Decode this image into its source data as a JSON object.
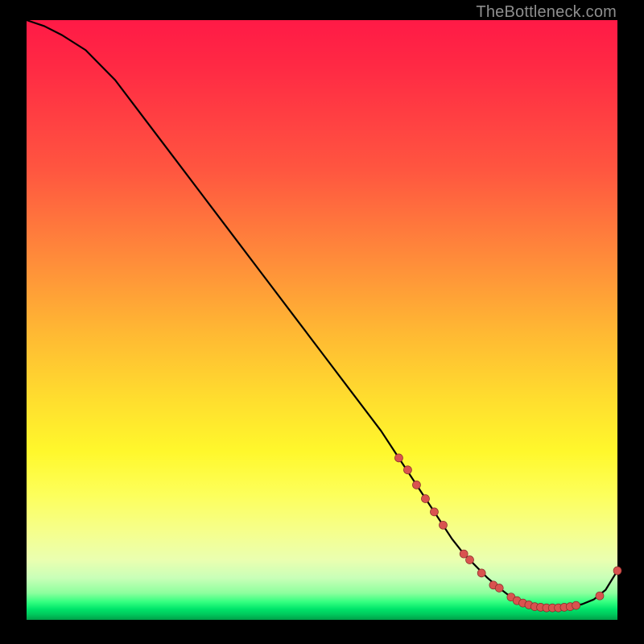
{
  "watermark": "TheBottleneck.com",
  "chart_data": {
    "type": "line",
    "title": "",
    "xlabel": "",
    "ylabel": "",
    "xlim": [
      0,
      100
    ],
    "ylim": [
      0,
      100
    ],
    "grid": false,
    "legend": false,
    "series": [
      {
        "name": "curve",
        "x": [
          0,
          3,
          6,
          10,
          15,
          20,
          25,
          30,
          35,
          40,
          45,
          50,
          55,
          60,
          63,
          66,
          69,
          72,
          74,
          76,
          78,
          80,
          82,
          84,
          86,
          88,
          90,
          92,
          94,
          96,
          98,
          100
        ],
        "y": [
          100,
          99,
          97.5,
          95,
          90,
          83.5,
          77,
          70.5,
          64,
          57.5,
          51,
          44.5,
          38,
          31.5,
          27,
          22.5,
          18,
          13.5,
          11,
          9,
          7,
          5.3,
          3.8,
          2.8,
          2.2,
          2.0,
          2.0,
          2.2,
          2.6,
          3.4,
          5.0,
          8.2
        ]
      }
    ],
    "markers": [
      {
        "x": 63,
        "y": 27
      },
      {
        "x": 64.5,
        "y": 25
      },
      {
        "x": 66,
        "y": 22.5
      },
      {
        "x": 67.5,
        "y": 20.2
      },
      {
        "x": 69,
        "y": 18
      },
      {
        "x": 70.5,
        "y": 15.8
      },
      {
        "x": 74,
        "y": 11
      },
      {
        "x": 75,
        "y": 10
      },
      {
        "x": 77,
        "y": 7.8
      },
      {
        "x": 79,
        "y": 5.8
      },
      {
        "x": 80,
        "y": 5.3
      },
      {
        "x": 82,
        "y": 3.8
      },
      {
        "x": 83,
        "y": 3.2
      },
      {
        "x": 84,
        "y": 2.8
      },
      {
        "x": 85,
        "y": 2.5
      },
      {
        "x": 86,
        "y": 2.2
      },
      {
        "x": 87,
        "y": 2.1
      },
      {
        "x": 88,
        "y": 2.0
      },
      {
        "x": 89,
        "y": 2.0
      },
      {
        "x": 90,
        "y": 2.0
      },
      {
        "x": 91,
        "y": 2.1
      },
      {
        "x": 92,
        "y": 2.2
      },
      {
        "x": 93,
        "y": 2.4
      },
      {
        "x": 97,
        "y": 4.0
      },
      {
        "x": 100,
        "y": 8.2
      }
    ],
    "colors": {
      "line": "#000000",
      "marker_fill": "#d9534f",
      "marker_stroke": "#862d2a",
      "gradient_top": "#ff1a46",
      "gradient_mid": "#fff82c",
      "gradient_bottom": "#00a048"
    },
    "marker_radius": 5
  }
}
